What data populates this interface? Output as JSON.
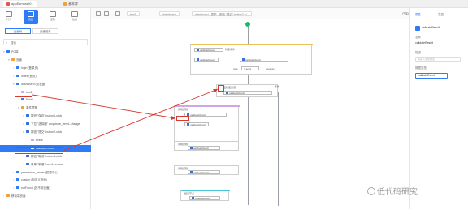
{
  "titlebar": {
    "tabs": [
      {
        "label": "appEsmoset01",
        "color": "#e2574c"
      },
      {
        "label": "基本库",
        "color": "#f0a33a"
      }
    ]
  },
  "leftrail": {
    "buttons": [
      {
        "label": "行为",
        "icon": "list-icon",
        "active": false
      },
      {
        "label": "页面",
        "icon": "page-icon",
        "active": true
      },
      {
        "label": "逻辑",
        "icon": "logic-icon",
        "active": false
      },
      {
        "label": "数据",
        "icon": "data-icon",
        "active": false
      }
    ],
    "subtabs": [
      "页面树",
      "页面组件"
    ],
    "search_placeholder": "搜索",
    "tree": [
      {
        "label": "PC端",
        "indent": 0,
        "toggle": "▾",
        "color": "#2f7bf5"
      },
      {
        "label": "页面",
        "indent": 1,
        "toggle": "▾",
        "color": "#f0a33a"
      },
      {
        "label": "login (登录页)",
        "indent": 2,
        "toggle": "›",
        "color": "#2f7bf5"
      },
      {
        "label": "index (首页)",
        "indent": 2,
        "toggle": "›",
        "color": "#2f7bf5"
      },
      {
        "label": "dashboard (仪表盘)",
        "indent": 2,
        "toggle": "▾",
        "color": "#2f7bf5"
      },
      {
        "label": "text1",
        "indent": 3,
        "toggle": "",
        "color": "#cfa7e8"
      },
      {
        "label": "Email",
        "indent": 3,
        "toggle": "›",
        "color": "#2f7bf5"
      },
      {
        "label": "事件逻辑",
        "indent": 3,
        "toggle": "▾",
        "color": "#f0a33a"
      },
      {
        "label": "按钮 \"保存\" button1-click",
        "indent": 4,
        "toggle": "›",
        "color": "#3a6fd8"
      },
      {
        "label": "下拉 \"选择器\" dropdown_item1-change",
        "indent": 4,
        "toggle": "›",
        "color": "#3a6fd8"
      },
      {
        "label": "按钮 \"提交\" button2-click",
        "indent": 4,
        "toggle": "▾",
        "color": "#3a6fd8"
      },
      {
        "label": "event",
        "indent": 5,
        "toggle": "",
        "color": "#cfa7e8"
      },
      {
        "label": "validateResult",
        "indent": 5,
        "toggle": "",
        "color": "#ffffff",
        "selected": true
      },
      {
        "label": "按钮 \"取消\" button3-click",
        "indent": 4,
        "toggle": "›",
        "color": "#3a6fd8"
      },
      {
        "label": "表单 \"新增\" form1-remove",
        "indent": 4,
        "toggle": "›",
        "color": "#3a6fd8"
      },
      {
        "label": "permission_center (权限中心)",
        "indent": 2,
        "toggle": "›",
        "color": "#2f7bf5"
      },
      {
        "label": "custom (自定义页面)",
        "indent": 2,
        "toggle": "›",
        "color": "#2f7bf5"
      },
      {
        "label": "notFound (找不到页面)",
        "indent": 2,
        "toggle": "›",
        "color": "#2f7bf5"
      },
      {
        "label": "移动端页面",
        "indent": 0,
        "toggle": "›",
        "color": "#f0a33a"
      }
    ]
  },
  "toolbar": {
    "crumbs": [
      "text1",
      "dashboard",
      "dashboard - 表单 - 按钮 \"提交\" button2-cl..."
    ],
    "save_label": "已保存"
  },
  "canvas": {
    "top_node": "validateResult",
    "condition_label": "判断条件",
    "cond_left": "type",
    "cond_op": "= text1",
    "cond_right": "boolean",
    "node1_title": "更新变量值",
    "node1_value": "validateResult",
    "node2_title": "调用逻辑",
    "node2_value": "validateResult",
    "node3_title": "调用逻辑",
    "node3_value": "validateResult",
    "node4_title": "调用逻辑",
    "node4_value": "validateResult",
    "node5_title": "调用逻辑",
    "node5_value": "validateResult",
    "bottom_title": "结束节点",
    "side_label": "条件"
  },
  "rightpanel": {
    "tabs": [
      "属性",
      "变量"
    ],
    "name_label": "名称",
    "name_value": "validateResult",
    "desc_label": "描述",
    "desc_placeholder": "请输入变量描述",
    "type_label": "数据类型",
    "type_value": "validateEvent"
  },
  "watermark": "低代码研究"
}
